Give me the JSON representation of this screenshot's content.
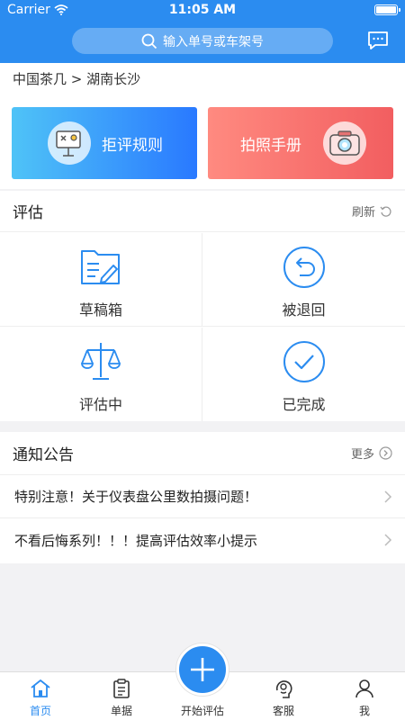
{
  "status": {
    "carrier": "Carrier",
    "time": "11:05 AM"
  },
  "search": {
    "placeholder": "输入单号或车架号"
  },
  "breadcrumb": "中国茶几 > 湖南长沙",
  "banners": {
    "left": "拒评规则",
    "right": "拍照手册"
  },
  "eval": {
    "title": "评估",
    "refresh": "刷新",
    "items": [
      "草稿箱",
      "被退回",
      "评估中",
      "已完成"
    ]
  },
  "notice": {
    "title": "通知公告",
    "more": "更多",
    "items": [
      "特别注意！关于仪表盘公里数拍摄问题！",
      "不看后悔系列！！！提高评估效率小提示"
    ]
  },
  "tabs": [
    "首页",
    "单据",
    "开始评估",
    "客服",
    "我"
  ],
  "colors": {
    "primary": "#2b8cf0",
    "banner_red": "#f25e60",
    "background": "#f2f2f4"
  }
}
